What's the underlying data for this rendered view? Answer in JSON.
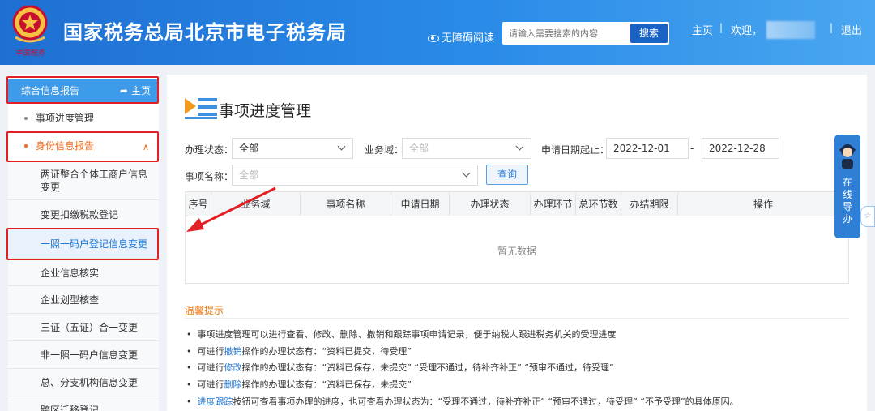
{
  "header": {
    "site_title": "国家税务总局北京市电子税务局",
    "accessibility": "无障碍阅读",
    "search_placeholder": "请输入需要搜索的内容",
    "search_button": "搜索",
    "nav_home": "主页",
    "nav_separator": "|",
    "nav_welcome": "欢迎，",
    "nav_logout": "退出",
    "logo_caption": "中国税务"
  },
  "sidebar": {
    "section_title": "综合信息报告",
    "home_link": "主页",
    "items": [
      {
        "label": "事项进度管理"
      },
      {
        "label": "身份信息报告"
      },
      {
        "label": "两证整合个体工商户信息变更"
      },
      {
        "label": "变更扣缴税款登记"
      },
      {
        "label": "一照一码户登记信息变更"
      },
      {
        "label": "企业信息核实"
      },
      {
        "label": "企业划型核查"
      },
      {
        "label": "三证（五证）合一变更"
      },
      {
        "label": "非一照一码户信息变更"
      },
      {
        "label": "总、分支机构信息变更"
      },
      {
        "label": "跨区迁移登记"
      }
    ]
  },
  "main": {
    "title": "事项进度管理",
    "filters": {
      "status_label": "办理状态：",
      "status_value": "全部",
      "domain_label": "业务域：",
      "domain_placeholder": "全部",
      "date_label": "申请日期起止：",
      "date_from": "2022-12-01",
      "date_sep": "-",
      "date_to": "2022-12-28",
      "name_label": "事项名称：",
      "name_placeholder": "全部",
      "query_button": "查询"
    },
    "table": {
      "columns": [
        "序号",
        "业务域",
        "事项名称",
        "申请日期",
        "办理状态",
        "办理环节",
        "总环节数",
        "办结期限",
        "操作"
      ],
      "empty_text": "暂无数据"
    },
    "tips": {
      "title": "温馨提示",
      "lines": [
        {
          "pre": "事项进度管理可以进行查看、修改、删除、撤销和跟踪事项申请记录，便于纳税人跟进税务机关的受理进度",
          "link": "",
          "post": ""
        },
        {
          "pre": "可进行",
          "link": "撤销",
          "post": "操作的办理状态有：“资料已提交，待受理”"
        },
        {
          "pre": "可进行",
          "link": "修改",
          "post": "操作的办理状态有：“资料已保存，未提交”  “受理不通过，待补齐补正”  “预审不通过，待受理”"
        },
        {
          "pre": "可进行",
          "link": "删除",
          "post": "操作的办理状态有：“资料已保存，未提交”"
        },
        {
          "pre": "",
          "link": "进度跟踪",
          "post": "按钮可查看事项办理的进度，也可查看办理状态为：“受理不通过，待补齐补正”  “预审不通过，待受理”  “不予受理”的具体原因。"
        }
      ]
    }
  },
  "guide": {
    "label_chars": [
      "在",
      "线",
      "导",
      "办"
    ]
  },
  "colors": {
    "header_blue": "#2a8be8",
    "sidebar_head": "#3d9bea",
    "accent_orange": "#f26b1d",
    "annotation_red": "#e31e24",
    "link_blue": "#1e78d6"
  }
}
